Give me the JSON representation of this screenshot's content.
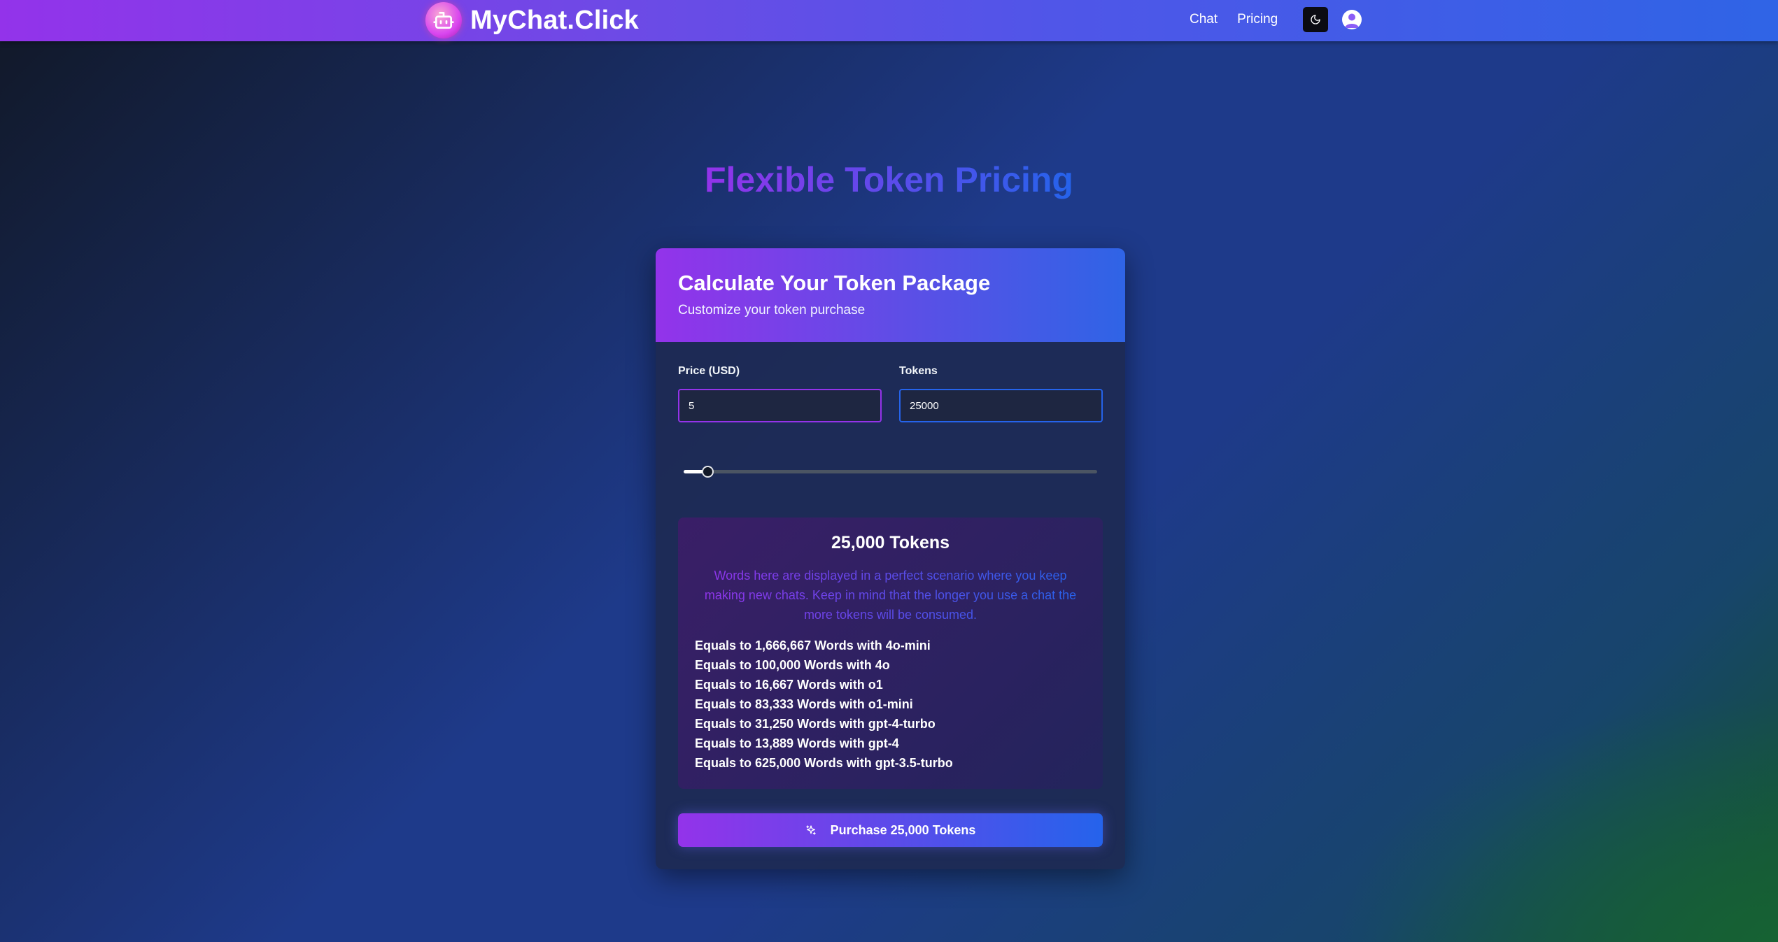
{
  "navbar": {
    "brand": "MyChat.Click",
    "links": [
      {
        "label": "Chat"
      },
      {
        "label": "Pricing"
      }
    ],
    "icons": {
      "logo": "robot-icon",
      "theme": "moon-icon",
      "user": "user-icon"
    }
  },
  "page": {
    "title": "Flexible Token Pricing"
  },
  "card": {
    "title": "Calculate Your Token Package",
    "subtitle": "Customize your token purchase",
    "price_label": "Price (USD)",
    "price_value": "5",
    "tokens_label": "Tokens",
    "tokens_value": "25000",
    "slider_level": 0.043,
    "summary_title": "25,000 Tokens",
    "note": "Words here are displayed in a perfect scenario where you keep making new chats. Keep in mind that the longer you use a chat the more tokens will be consumed.",
    "equivalents": [
      "Equals to 1,666,667 Words with 4o-mini",
      "Equals to 100,000 Words with 4o",
      "Equals to 16,667 Words with o1",
      "Equals to 83,333 Words with o1-mini",
      "Equals to 31,250 Words with gpt-4-turbo",
      "Equals to 13,889 Words with gpt-4",
      "Equals to 625,000 Words with gpt-3.5-turbo"
    ],
    "purchase_label": "Purchase 25,000 Tokens"
  },
  "colors": {
    "accent_purple": "#9333ea",
    "accent_blue": "#2563eb"
  }
}
